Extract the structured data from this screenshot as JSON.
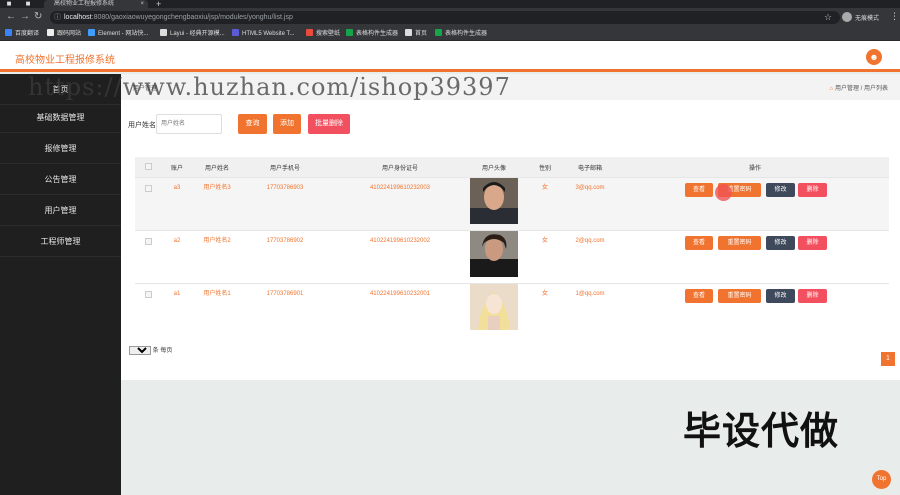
{
  "browser": {
    "tab_title": "高校物业工程报修系统",
    "url_host": "localhost",
    "url_rest": ":8080/gaoxiaowuyegongchengbaoxiu/jsp/modules/yonghu/list.jsp",
    "incognito_label": "无痕模式",
    "bookmarks": [
      "百度翻译",
      "跟码网站",
      "Element - 网站快...",
      "Layui - 经典开源模...",
      "HTML5 Website T...",
      "搜索壁纸",
      "表格构件生成器",
      "首页",
      "表格构件生成器"
    ]
  },
  "header": {
    "app_title": "高校物业工程报修系统"
  },
  "sidebar": {
    "home": "首页",
    "items": [
      {
        "label": "基础数据管理"
      },
      {
        "label": "报修管理"
      },
      {
        "label": "公告管理"
      },
      {
        "label": "用户管理"
      },
      {
        "label": "工程师管理"
      }
    ]
  },
  "breadcrumb": {
    "left": "用户管理",
    "right": "用户管理 / 用户列表"
  },
  "search": {
    "label": "用户姓名",
    "placeholder": "用户姓名",
    "query_button": "查询",
    "add_button": "添加",
    "batch_delete_button": "批量删除"
  },
  "table": {
    "headers": [
      "账户",
      "用户姓名",
      "用户手机号",
      "用户身份证号",
      "用户头像",
      "性别",
      "电子邮箱",
      "操作"
    ],
    "rows": [
      {
        "account": "a3",
        "name": "用户姓名3",
        "phone": "17703786903",
        "id_card": "410224199610232003",
        "gender": "女",
        "email": "3@qq.com"
      },
      {
        "account": "a2",
        "name": "用户姓名2",
        "phone": "17703786902",
        "id_card": "410224199610232002",
        "gender": "女",
        "email": "2@qq.com"
      },
      {
        "account": "a1",
        "name": "用户姓名1",
        "phone": "17703786901",
        "id_card": "410224199610232001",
        "gender": "女",
        "email": "1@qq.com"
      }
    ],
    "actions": {
      "view": "查看",
      "reset": "重置密码",
      "edit": "修改",
      "delete": "删除"
    }
  },
  "pager": {
    "page_size": "10",
    "per_page_label": "条 每页",
    "current_page": "1"
  },
  "overlay": {
    "watermark_url": "https://www.huzhan.com/ishop39397",
    "watermark_text": "毕设代做",
    "top_button": "Top"
  },
  "colors": {
    "accent": "#f0742f",
    "danger": "#f24f5f",
    "dark_button": "#3e4a5c",
    "sidebar": "#1f1f1f"
  }
}
